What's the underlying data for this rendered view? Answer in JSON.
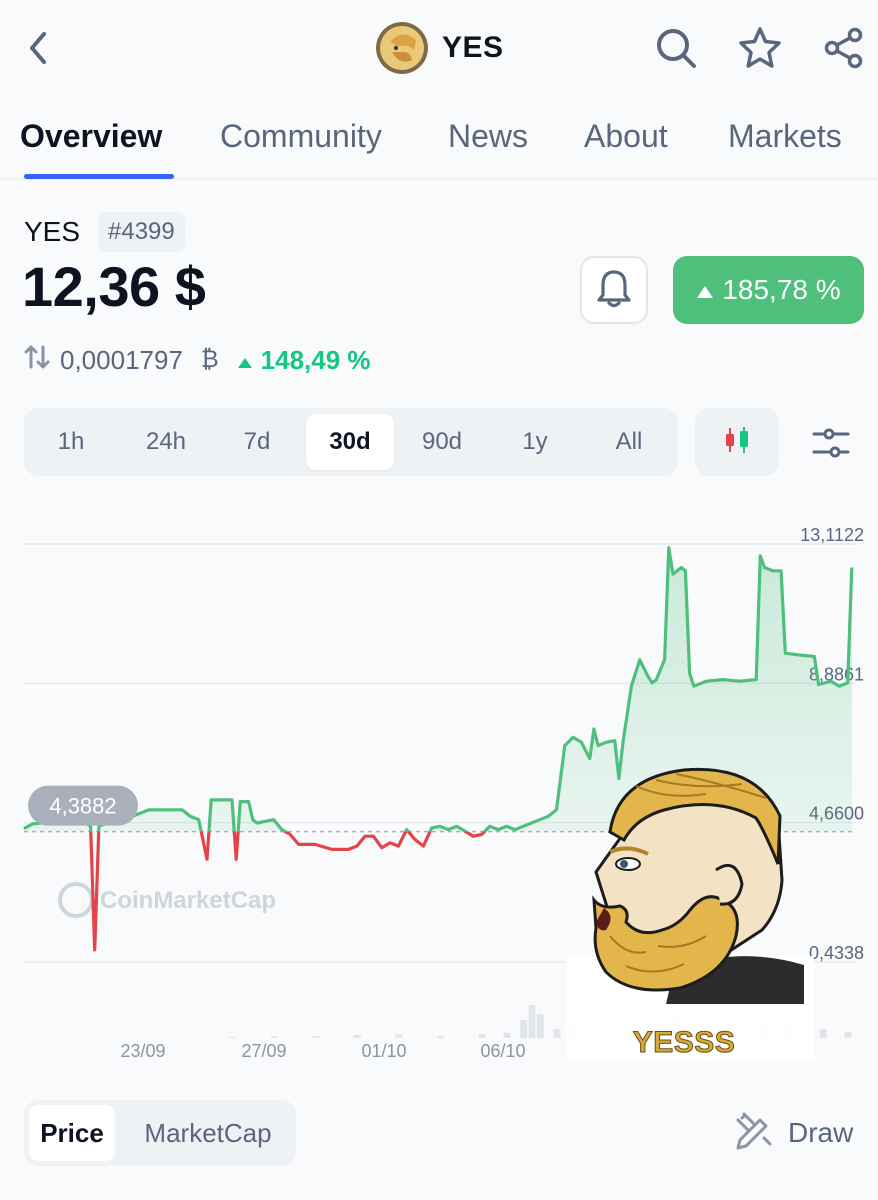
{
  "header": {
    "title": "YES",
    "back_icon": "chevron-left-icon",
    "icons": [
      "search-icon",
      "star-icon",
      "share-icon"
    ]
  },
  "tabs": [
    {
      "label": "Overview",
      "active": true
    },
    {
      "label": "Community"
    },
    {
      "label": "News"
    },
    {
      "label": "About"
    },
    {
      "label": "Markets"
    }
  ],
  "coin": {
    "symbol": "YES",
    "rank": "#4399",
    "price": "12,36 $",
    "change_pct": "185,78 %",
    "btc_price": "0,0001797",
    "btc_symbol": "₿",
    "btc_change_pct": "148,49 %"
  },
  "ranges": [
    {
      "label": "1h"
    },
    {
      "label": "24h"
    },
    {
      "label": "7d"
    },
    {
      "label": "30d",
      "active": true
    },
    {
      "label": "90d"
    },
    {
      "label": "1y"
    },
    {
      "label": "All"
    }
  ],
  "chart_data": {
    "type": "line",
    "y_ticks": [
      "13,1122",
      "8,8861",
      "4,6600",
      "0,4338"
    ],
    "x_ticks": [
      "23/09",
      "27/09",
      "01/10",
      "06/10"
    ],
    "baseline_label": "4,3882",
    "baseline": 4.3882,
    "ylim": [
      0.4338,
      13.1122
    ],
    "watermark": "CoinMarketCap",
    "x_index_range": [
      0,
      100
    ],
    "points": [
      [
        0,
        4.48
      ],
      [
        1,
        4.62
      ],
      [
        2,
        4.65
      ],
      [
        3,
        4.68
      ],
      [
        4,
        4.75
      ],
      [
        5,
        4.72
      ],
      [
        6,
        4.7
      ],
      [
        7,
        4.72
      ],
      [
        8,
        4.55
      ],
      [
        8.5,
        0.8
      ],
      [
        9,
        4.55
      ],
      [
        10,
        4.65
      ],
      [
        11,
        4.62
      ],
      [
        13,
        4.85
      ],
      [
        15,
        5.05
      ],
      [
        17,
        5.05
      ],
      [
        19,
        5.05
      ],
      [
        20,
        4.85
      ],
      [
        21,
        4.75
      ],
      [
        22,
        3.55
      ],
      [
        22.5,
        5.35
      ],
      [
        24,
        5.35
      ],
      [
        25,
        5.35
      ],
      [
        25.5,
        3.55
      ],
      [
        26,
        5.3
      ],
      [
        27,
        5.3
      ],
      [
        27.5,
        4.75
      ],
      [
        28,
        4.65
      ],
      [
        30,
        4.75
      ],
      [
        31,
        4.45
      ],
      [
        32,
        4.3
      ],
      [
        33,
        4.0
      ],
      [
        35,
        4.0
      ],
      [
        37,
        3.85
      ],
      [
        39,
        3.85
      ],
      [
        40,
        3.95
      ],
      [
        41,
        4.25
      ],
      [
        42,
        4.25
      ],
      [
        43,
        3.9
      ],
      [
        44,
        4.05
      ],
      [
        45,
        3.95
      ],
      [
        46,
        4.45
      ],
      [
        47,
        4.15
      ],
      [
        48,
        3.95
      ],
      [
        49,
        4.5
      ],
      [
        50,
        4.55
      ],
      [
        51,
        4.45
      ],
      [
        52,
        4.55
      ],
      [
        53,
        4.4
      ],
      [
        54,
        4.25
      ],
      [
        55,
        4.3
      ],
      [
        56,
        4.55
      ],
      [
        57,
        4.45
      ],
      [
        58,
        4.55
      ],
      [
        59,
        4.45
      ],
      [
        60,
        4.55
      ],
      [
        61,
        4.65
      ],
      [
        62,
        4.75
      ],
      [
        63,
        4.85
      ],
      [
        64,
        5.05
      ],
      [
        65,
        7.0
      ],
      [
        66,
        7.25
      ],
      [
        67,
        7.1
      ],
      [
        68,
        6.6
      ],
      [
        68.5,
        7.5
      ],
      [
        69,
        7.0
      ],
      [
        70,
        7.1
      ],
      [
        71,
        7.15
      ],
      [
        71.5,
        6.0
      ],
      [
        72,
        7.1
      ],
      [
        73,
        8.8
      ],
      [
        74,
        9.6
      ],
      [
        75,
        9.1
      ],
      [
        75.5,
        8.9
      ],
      [
        76,
        9.0
      ],
      [
        77,
        9.6
      ],
      [
        77.5,
        13.0
      ],
      [
        78,
        12.2
      ],
      [
        79,
        12.4
      ],
      [
        79.5,
        12.3
      ],
      [
        80,
        9.2
      ],
      [
        80.5,
        8.8
      ],
      [
        82,
        8.95
      ],
      [
        84,
        9.0
      ],
      [
        86,
        8.95
      ],
      [
        88,
        9.0
      ],
      [
        88.5,
        12.75
      ],
      [
        89,
        12.4
      ],
      [
        90,
        12.3
      ],
      [
        91,
        12.3
      ],
      [
        91.5,
        9.8
      ],
      [
        93,
        9.75
      ],
      [
        95,
        9.7
      ],
      [
        95.5,
        8.85
      ],
      [
        97,
        8.95
      ],
      [
        98,
        8.8
      ],
      [
        99,
        8.9
      ],
      [
        99.5,
        12.4
      ]
    ],
    "volume": [
      [
        25,
        0.2
      ],
      [
        30,
        0.3
      ],
      [
        35,
        0.3
      ],
      [
        40,
        0.5
      ],
      [
        45,
        0.6
      ],
      [
        50,
        0.4
      ],
      [
        55,
        0.6
      ],
      [
        58,
        0.9
      ],
      [
        60,
        3.0
      ],
      [
        61,
        5.5
      ],
      [
        62,
        4.0
      ],
      [
        64,
        1.5
      ],
      [
        66,
        2.5
      ],
      [
        70,
        1.5
      ],
      [
        75,
        2.0
      ],
      [
        78,
        3.5
      ],
      [
        80,
        2.0
      ],
      [
        85,
        1.5
      ],
      [
        89,
        3.0
      ],
      [
        92,
        2.0
      ],
      [
        96,
        1.5
      ],
      [
        99,
        1.0
      ]
    ],
    "up_color": "#4fbf7c",
    "down_color": "#e2444a"
  },
  "meme_caption": "YESSS",
  "bottom": {
    "toggle": [
      {
        "label": "Price",
        "active": true
      },
      {
        "label": "MarketCap"
      }
    ],
    "draw_label": "Draw",
    "draw_icon": "pencil-ruler-icon"
  }
}
